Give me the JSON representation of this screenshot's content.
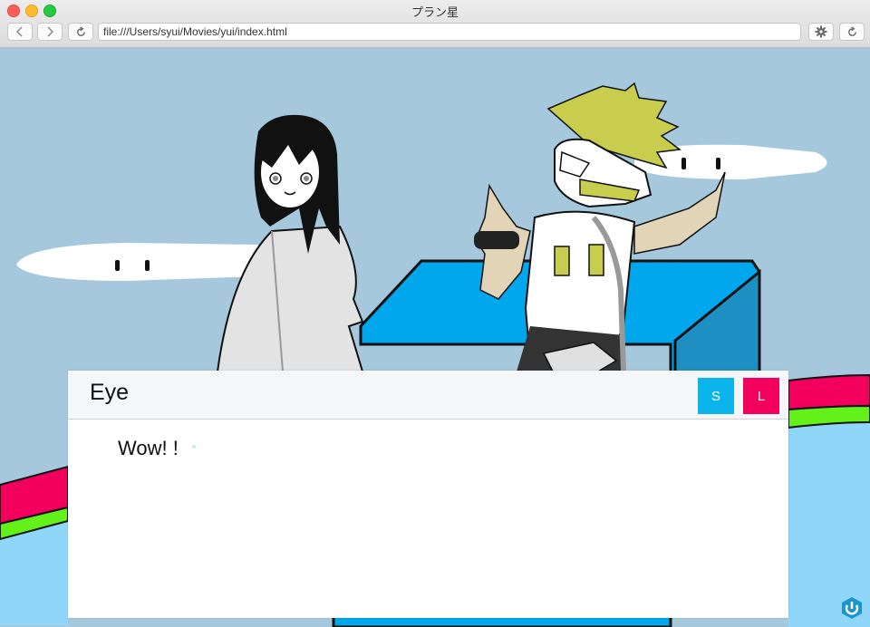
{
  "browser": {
    "title": "プラン星",
    "url": "file:///Users/syui/Movies/yui/index.html",
    "back_icon": "chevron-left-icon",
    "forward_icon": "chevron-right-icon",
    "reload_icon": "reload-icon",
    "settings_icon": "gear-icon"
  },
  "dialog": {
    "speaker": "Eye",
    "text": "Wow! !",
    "save_label": "S",
    "load_label": "L",
    "save_color": "#0bb5ec",
    "load_color": "#f3005f"
  },
  "scene": {
    "sky_color": "#a6c8dc",
    "characters": [
      "girl-character",
      "masked-blond-character"
    ],
    "logo_icon": "power-logo-icon"
  }
}
